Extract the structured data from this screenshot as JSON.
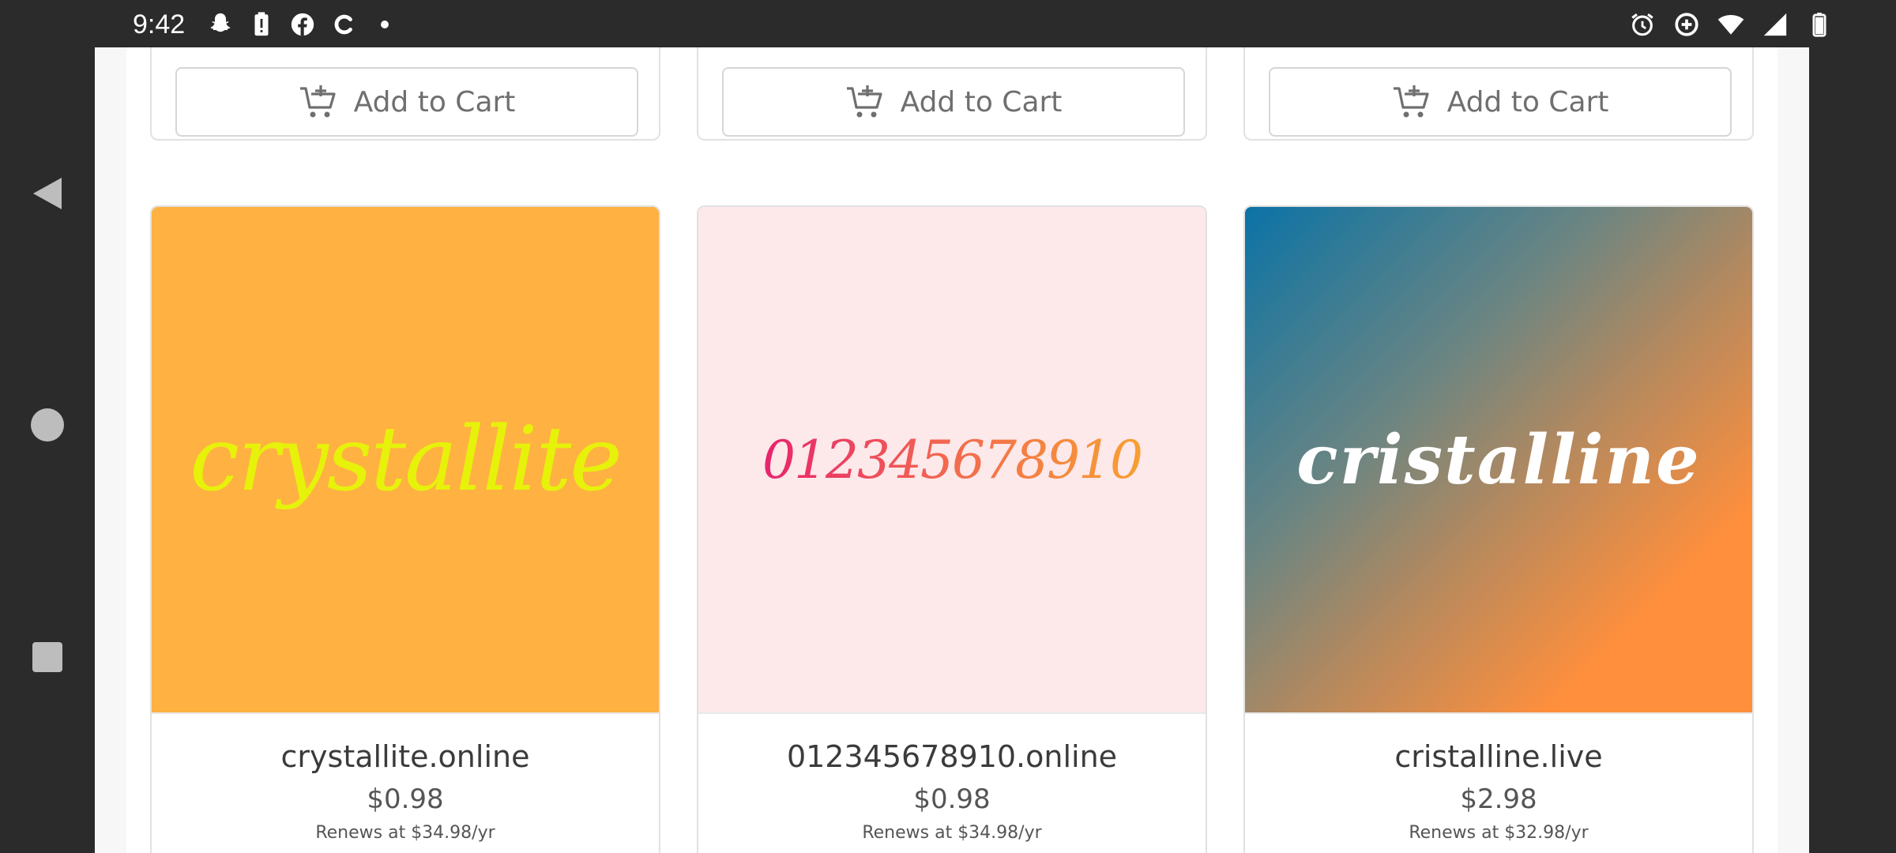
{
  "status_bar": {
    "time": "9:42",
    "left_icons": [
      "snapchat-icon",
      "battery-alert-icon",
      "facebook-icon",
      "c-app-icon",
      "dot-icon"
    ],
    "right_icons": [
      "alarm-icon",
      "data-saver-icon",
      "wifi-icon",
      "signal-icon",
      "battery-icon"
    ]
  },
  "nav": {
    "back_icon": "back-triangle-icon",
    "home_icon": "home-circle-icon",
    "recents_icon": "recents-square-icon"
  },
  "top_row": {
    "cart_label": "Add to Cart"
  },
  "products": [
    {
      "art_text": "crystallite",
      "domain": "crystallite.online",
      "price": "$0.98",
      "renews": "Renews at $34.98/yr"
    },
    {
      "art_text": "012345678910",
      "domain": "012345678910.online",
      "price": "$0.98",
      "renews": "Renews at $34.98/yr"
    },
    {
      "art_text": "cristalline",
      "domain": "cristalline.live",
      "price": "$2.98",
      "renews": "Renews at $32.98/yr"
    }
  ],
  "colors": {
    "card1_bg": "#ffb142",
    "card1_text": "#e6f20a",
    "card2_bg": "#fde8ea",
    "card3_gradient_start": "#0b73a6",
    "card3_gradient_end": "#ff8f3c"
  }
}
